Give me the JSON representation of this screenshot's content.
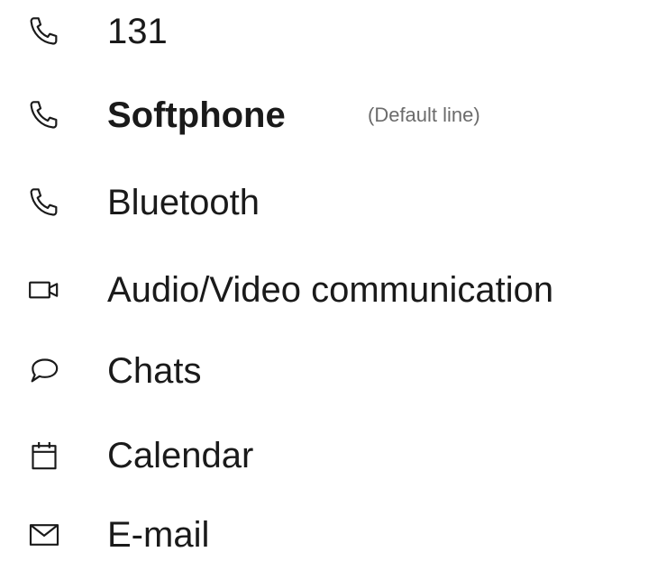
{
  "menu": {
    "items": [
      {
        "label": "131",
        "icon": "phone-icon"
      },
      {
        "label": "Softphone",
        "icon": "phone-icon",
        "note": "(Default line)",
        "active": true
      },
      {
        "label": "Bluetooth",
        "icon": "phone-icon"
      },
      {
        "label": "Audio/Video communication",
        "icon": "video-camera-icon"
      },
      {
        "label": "Chats",
        "icon": "chat-bubble-icon"
      },
      {
        "label": "Calendar",
        "icon": "calendar-icon"
      },
      {
        "label": "E-mail",
        "icon": "envelope-icon"
      }
    ]
  },
  "colors": {
    "text": "#1a1a1a",
    "note": "#6b6b6b",
    "background": "#ffffff"
  }
}
